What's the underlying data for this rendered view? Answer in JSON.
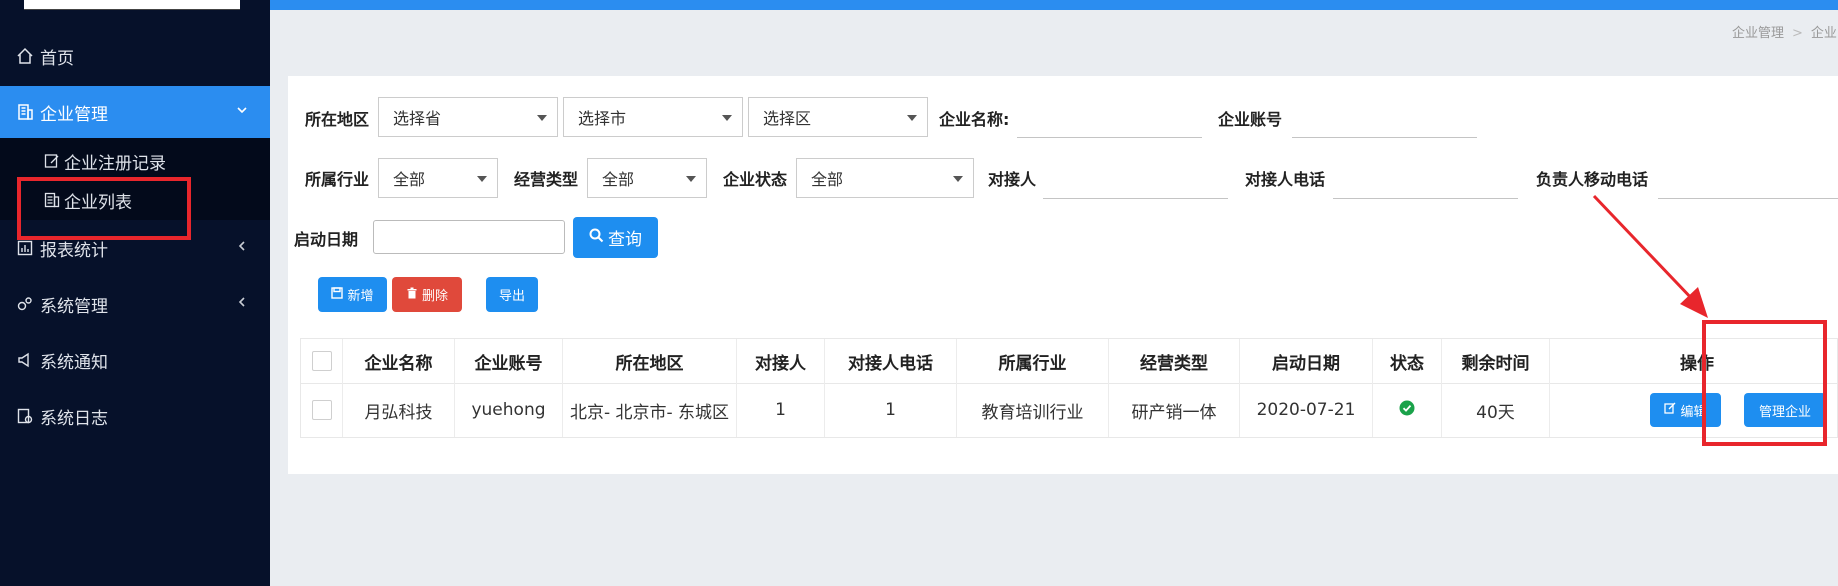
{
  "sidebar": {
    "items": [
      {
        "label": "首页",
        "icon": "home-icon"
      },
      {
        "label": "企业管理",
        "icon": "building-icon"
      },
      {
        "label": "报表统计",
        "icon": "chart-icon"
      },
      {
        "label": "系统管理",
        "icon": "gears-icon"
      },
      {
        "label": "系统通知",
        "icon": "megaphone-icon"
      },
      {
        "label": "系统日志",
        "icon": "log-icon"
      }
    ],
    "sub_items": [
      {
        "label": "企业注册记录",
        "icon": "edit-doc-icon"
      },
      {
        "label": "企业列表",
        "icon": "list-doc-icon"
      }
    ]
  },
  "breadcrumb": {
    "item1": "企业管理",
    "separator": ">",
    "item2": "企业"
  },
  "filters": {
    "region_label": "所在地区",
    "province_value": "选择省",
    "city_value": "选择市",
    "district_value": "选择区",
    "name_label": "企业名称:",
    "account_label": "企业账号",
    "industry_label": "所属行业",
    "industry_value": "全部",
    "biz_type_label": "经营类型",
    "biz_type_value": "全部",
    "status_label": "企业状态",
    "status_value": "全部",
    "contact_label": "对接人",
    "contact_phone_label": "对接人电话",
    "owner_phone_label": "负责人移动电话",
    "start_date_label": "启动日期",
    "query_button": "查询"
  },
  "actions": {
    "add": "新增",
    "delete": "删除",
    "export": "导出"
  },
  "table": {
    "headers": [
      "企业名称",
      "企业账号",
      "所在地区",
      "对接人",
      "对接人电话",
      "所属行业",
      "经营类型",
      "启动日期",
      "状态",
      "剩余时间",
      "操作"
    ],
    "rows": [
      {
        "name": "月弘科技",
        "account": "yuehong",
        "region": "北京- 北京市- 东城区",
        "contact": "1",
        "contact_phone": "1",
        "industry": "教育培训行业",
        "biz_type": "研产销一体",
        "start_date": "2020-07-21",
        "status_icon": "check-circle-icon",
        "remaining": "40天",
        "edit_button": "编辑",
        "manage_button": "管理企业"
      }
    ]
  },
  "colors": {
    "primary": "#1e8ef0",
    "danger": "#e0493b",
    "sidebar": "#06112a",
    "annotation": "#e8262c",
    "success": "#1aa24a"
  }
}
